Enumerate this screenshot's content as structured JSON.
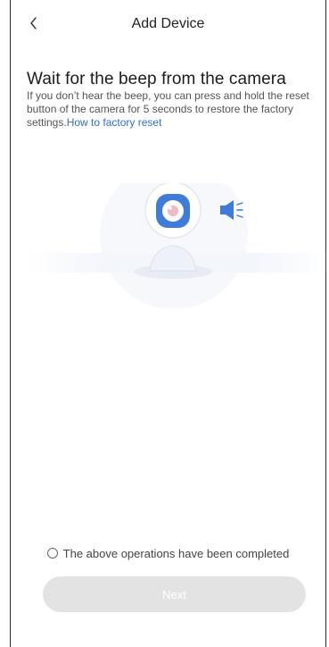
{
  "header": {
    "title": "Add Device"
  },
  "content": {
    "heading": "Wait for the beep from the camera",
    "description": "If you don’t hear the beep, you can press and hold the reset button of the camera for 5 seconds to restore the factory settings.",
    "link_text": "How to factory reset"
  },
  "confirmation": {
    "label": "The above operations have been completed",
    "checked": false
  },
  "actions": {
    "next_label": "Next"
  },
  "colors": {
    "link": "#2f6fd6",
    "accent": "#3f7bd9",
    "button_disabled": "#e3e3e3"
  },
  "icons": {
    "back": "chevron-left-icon",
    "sound": "speaker-icon"
  }
}
